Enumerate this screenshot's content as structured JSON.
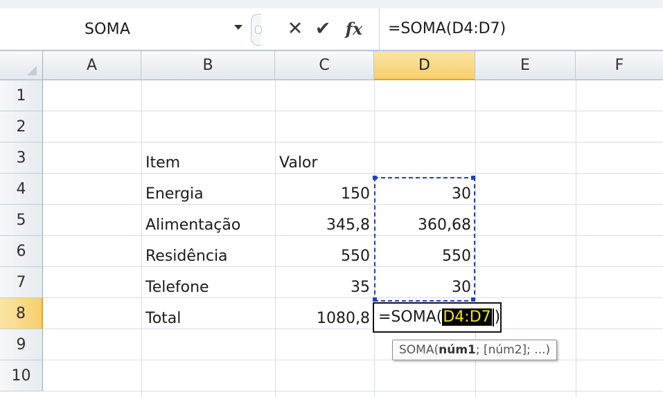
{
  "formula_bar": {
    "name_box": "SOMA",
    "formula": "=SOMA(D4:D7)",
    "cancel_icon": "✕",
    "enter_icon": "✔",
    "fx_label": "fx"
  },
  "columns": [
    "A",
    "B",
    "C",
    "D",
    "E",
    "F"
  ],
  "active_column": "D",
  "rows": [
    "1",
    "2",
    "3",
    "4",
    "5",
    "6",
    "7",
    "8",
    "9",
    "10"
  ],
  "active_row": "8",
  "cells": {
    "B3": "Item",
    "C3": "Valor",
    "B4": "Energia",
    "C4": "150",
    "D4": "30",
    "B5": "Alimentação",
    "C5": "345,8",
    "D5": "360,68",
    "B6": "Residência",
    "C6": "550",
    "D6": "550",
    "B7": "Telefone",
    "C7": "35",
    "D7": "30",
    "B8": "Total",
    "C8": "1080,8"
  },
  "editing": {
    "prefix": "=SOMA(",
    "reference": "D4:D7",
    "suffix": ")"
  },
  "tooltip": {
    "fn": "SOMA(",
    "arg1": "núm1",
    "rest": "; [núm2]; ...)"
  },
  "colors": {
    "active_header": "#f7cf6e",
    "range_border": "#1f3ecf",
    "reference_highlight": "#f5e600"
  }
}
